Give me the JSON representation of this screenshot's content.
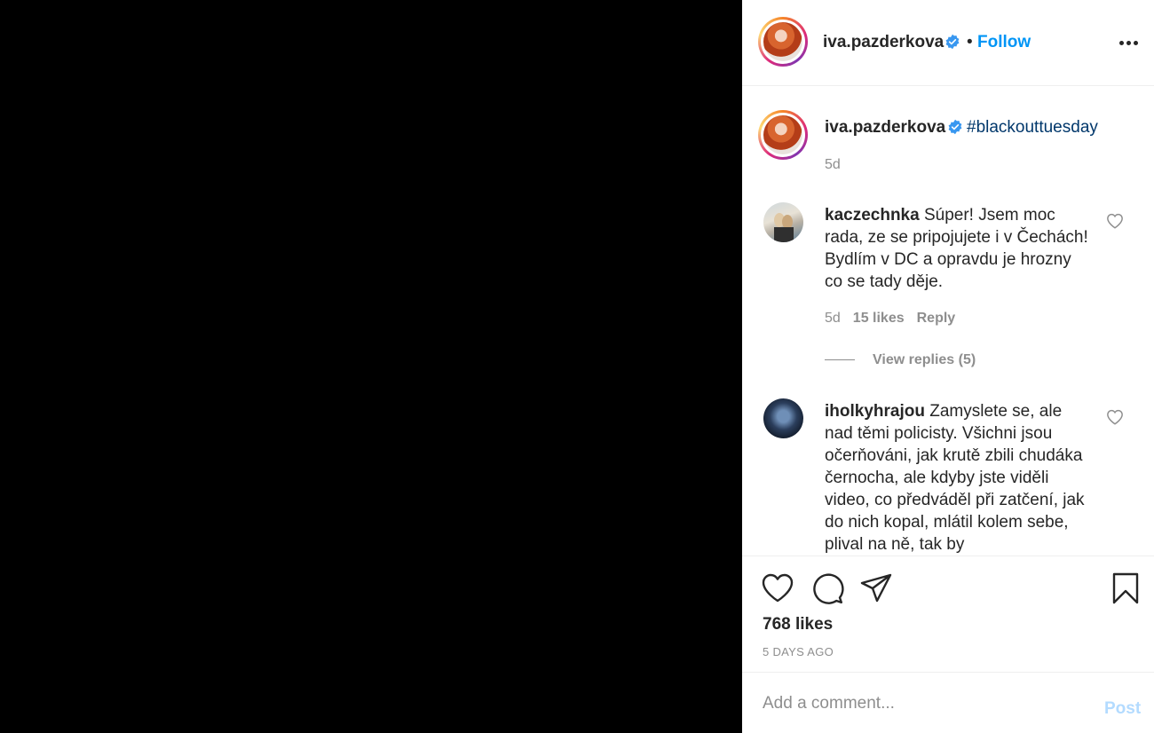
{
  "post": {
    "author": "iva.pazderkova",
    "follow_label": "Follow",
    "separator": "•",
    "more_icon": "more-horizontal-icon",
    "verified_icon": "verified-badge-icon"
  },
  "caption": {
    "author": "iva.pazderkova",
    "hashtag": "#blackouttuesday",
    "time": "5d"
  },
  "comments": [
    {
      "user": "kaczechnka",
      "text": "Súper! Jsem moc rada, ze se pripojujete i v Čechách! Bydlím v DC a opravdu je hrozny co se tady děje.",
      "time": "5d",
      "likes": "15 likes",
      "reply_label": "Reply",
      "view_replies": "View replies (5)"
    },
    {
      "user": "iholkyhrajou",
      "text": "Zamyslete se, ale nad těmi policisty. Všichni jsou očerňováni, jak krutě zbili chudáka černocha, ale kdyby jste viděli video, co předváděl při zatčení, jak do nich kopal, mlátil kolem sebe, plival na ně, tak by"
    }
  ],
  "actions": {
    "like_icon": "heart-icon",
    "comment_icon": "comment-icon",
    "share_icon": "send-icon",
    "save_icon": "bookmark-icon",
    "likes": "768 likes",
    "age": "5 DAYS AGO"
  },
  "add_comment": {
    "placeholder": "Add a comment...",
    "post_label": "Post"
  },
  "colors": {
    "link_blue": "#0095f6",
    "hashtag": "#00376b",
    "muted": "#8e8e8e",
    "post_disabled": "#b3dbff",
    "verified": "#3897f0"
  }
}
